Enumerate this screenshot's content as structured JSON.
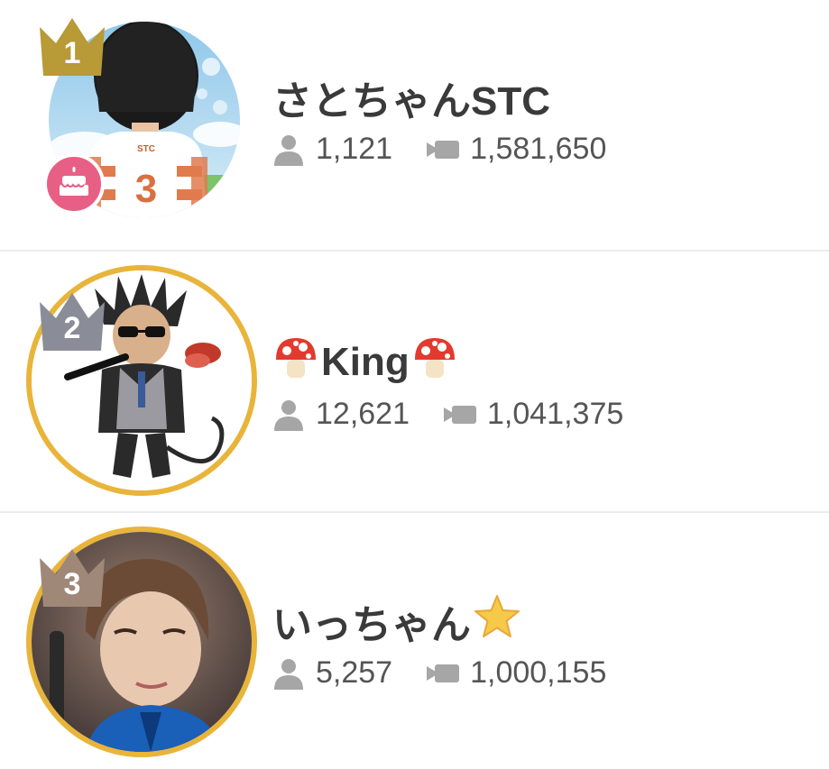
{
  "ranking": [
    {
      "rank": "1",
      "name": "さとちゃんSTC",
      "name_prefix_emoji": "",
      "name_suffix_emoji": "",
      "followers": "1,121",
      "views": "1,581,650",
      "crown_color": "#b89a36",
      "ring_color": "",
      "birthday_badge": true,
      "avatar_jersey_text": "STC",
      "avatar_jersey_number": "3"
    },
    {
      "rank": "2",
      "name": "King",
      "name_prefix_emoji": "mushroom",
      "name_suffix_emoji": "mushroom",
      "followers": "12,621",
      "views": "1,041,375",
      "crown_color": "#8a8d97",
      "ring_color": "#e8b43a",
      "birthday_badge": false
    },
    {
      "rank": "3",
      "name": "いっちゃん",
      "name_prefix_emoji": "",
      "name_suffix_emoji": "star",
      "followers": "5,257",
      "views": "1,000,155",
      "crown_color": "#a08878",
      "ring_color": "#e8b43a",
      "birthday_badge": false
    }
  ],
  "icons": {
    "followers": "person-icon",
    "views": "video-camera-icon",
    "birthday": "cake-icon"
  },
  "colors": {
    "stat_icon": "#a6a6a6",
    "birthday_badge": "#e85f86",
    "gold_ring": "#e8b43a"
  }
}
